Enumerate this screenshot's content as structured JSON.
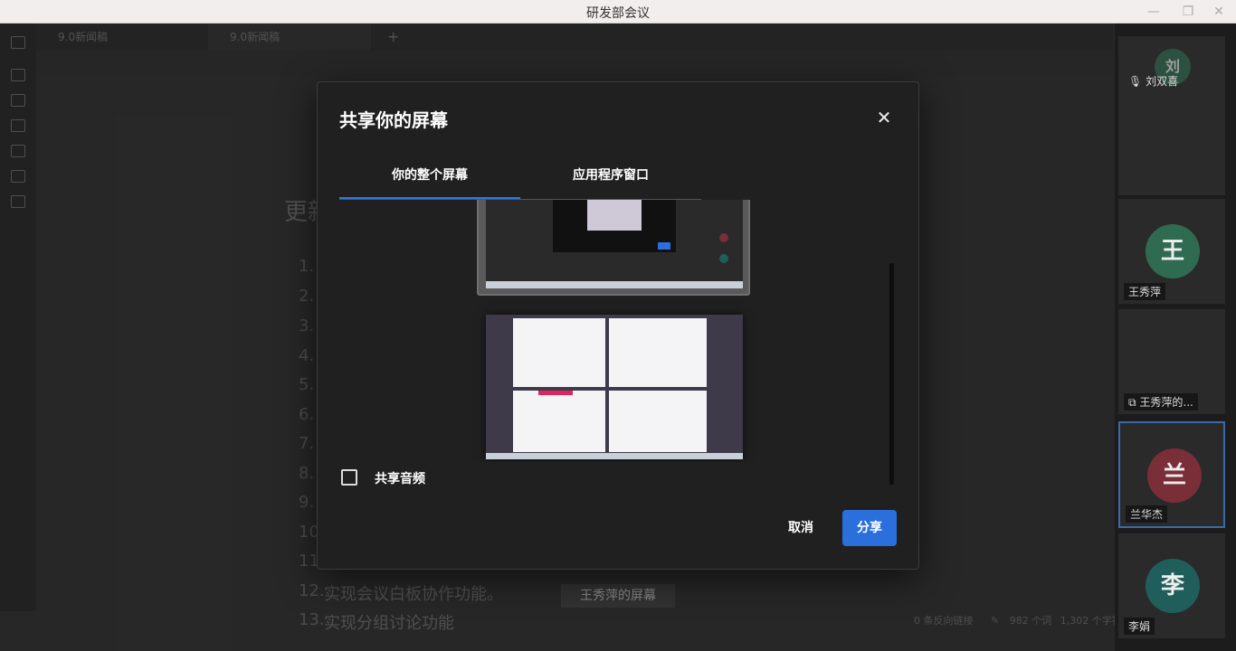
{
  "window": {
    "title": "研发部会议",
    "minimize": "—",
    "restore": "❐",
    "close": "✕"
  },
  "editor": {
    "tabs": [
      "9.0新闻稿",
      "9.0新闻稿"
    ],
    "new_tab": "+",
    "heading": "更新",
    "numbers": [
      "1.",
      "2.",
      "3.",
      "4.",
      "5.",
      "6.",
      "7.",
      "8.",
      "9.",
      "10.",
      "11.",
      "12.",
      "13."
    ],
    "line12": "实现会议白板协作功能。",
    "line13": "实现分组讨论功能",
    "status_backlinks": "0 条反向链接",
    "status_words": "982 个词",
    "status_chars": "1,302 个字符"
  },
  "caption": "王秀萍的屏幕",
  "participants": [
    {
      "name": "刘双喜",
      "avatar": "刘",
      "color": "#2f6b50"
    },
    {
      "name": "王秀萍",
      "avatar": "王",
      "color": "#2f6b50"
    },
    {
      "name": "王秀萍的...",
      "avatar": "",
      "color": ""
    },
    {
      "name": "兰华杰",
      "avatar": "兰",
      "color": "#7a2e37"
    },
    {
      "name": "李娟",
      "avatar": "李",
      "color": "#1f5e5a"
    }
  ],
  "dialog": {
    "title": "共享你的屏幕",
    "close": "✕",
    "tab_screen": "你的整个屏幕",
    "tab_app": "应用程序窗口",
    "share_audio": "共享音频",
    "cancel": "取消",
    "share": "分享"
  }
}
